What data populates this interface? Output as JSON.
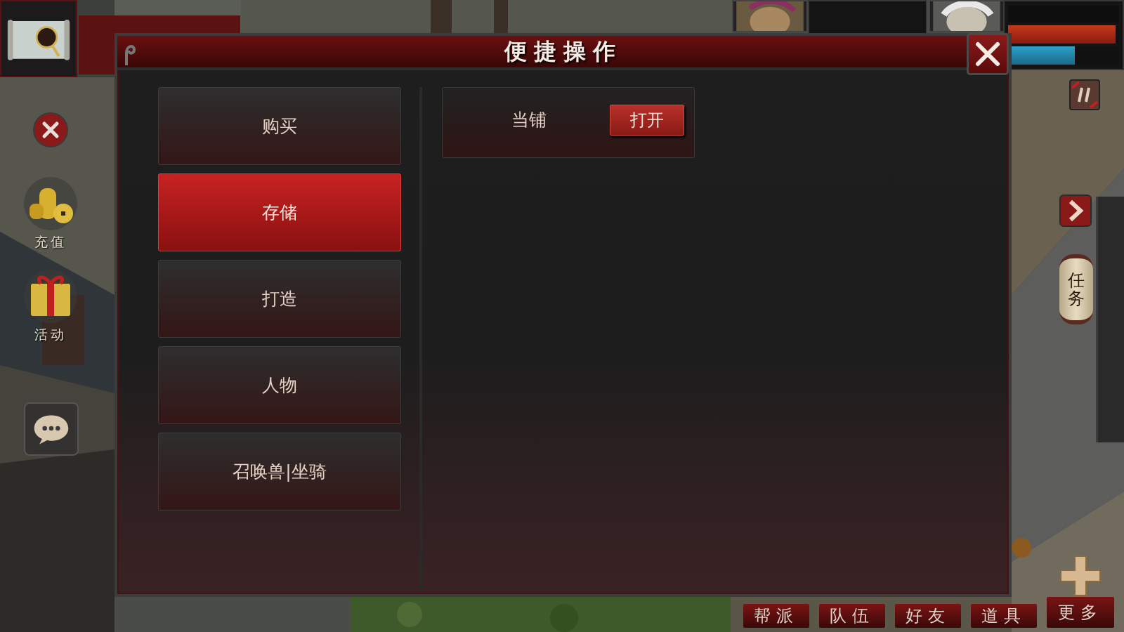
{
  "hud": {
    "side_buttons": [
      {
        "kind": "coins",
        "label": "充值"
      },
      {
        "kind": "gift",
        "label": "活动"
      }
    ],
    "status_bars": [
      {
        "kind": "hp",
        "level": 0.97
      },
      {
        "kind": "mp",
        "level": 0.6
      }
    ],
    "quest_lantern": "任务",
    "bottom_tabs": [
      "帮派",
      "队伍",
      "好友",
      "道具"
    ],
    "more_button": "更多"
  },
  "dialog": {
    "title": "便捷操作",
    "menu": [
      {
        "label": "购买",
        "selected": false
      },
      {
        "label": "存储",
        "selected": true
      },
      {
        "label": "打造",
        "selected": false
      },
      {
        "label": "人物",
        "selected": false
      },
      {
        "label": "召唤兽|坐骑",
        "selected": false
      }
    ],
    "entries": [
      {
        "label": "当铺",
        "action": "打开"
      }
    ]
  }
}
